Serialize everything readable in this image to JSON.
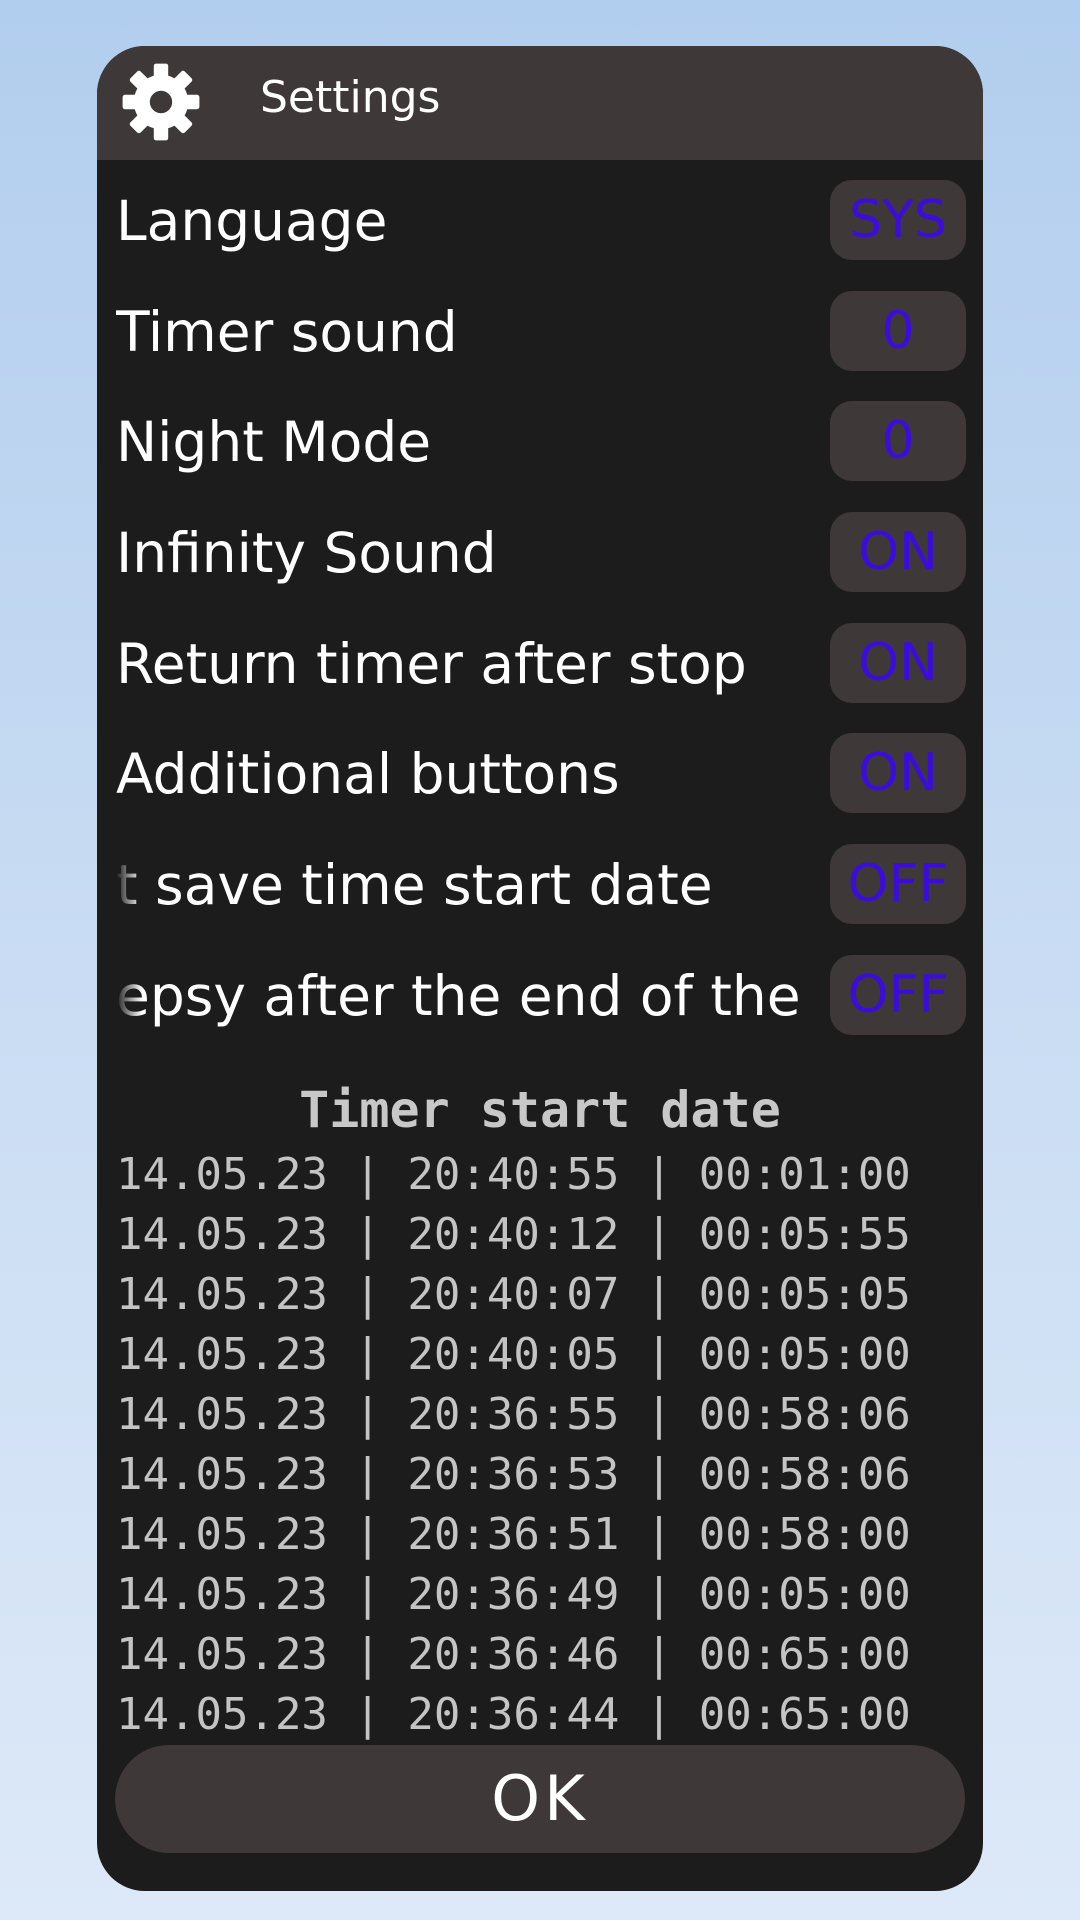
{
  "header": {
    "title": "Settings",
    "icon": "gear-icon"
  },
  "settings": [
    {
      "label": "Language",
      "value": "SYS"
    },
    {
      "label": "Timer sound",
      "value": "0"
    },
    {
      "label": "Night Mode",
      "value": "0"
    },
    {
      "label": "Infinity Sound",
      "value": "ON"
    },
    {
      "label": "Return timer after stop",
      "value": "ON"
    },
    {
      "label": "Additional buttons",
      "value": "ON"
    },
    {
      "label": "t save time start date",
      "value": "OFF"
    },
    {
      "label": "epsy after the end of the",
      "value": "OFF"
    }
  ],
  "history": {
    "title": "Timer start date",
    "rows": [
      "14.05.23 | 20:40:55 | 00:01:00",
      "14.05.23 | 20:40:12 | 00:05:55",
      "14.05.23 | 20:40:07 | 00:05:05",
      "14.05.23 | 20:40:05 | 00:05:00",
      "14.05.23 | 20:36:55 | 00:58:06",
      "14.05.23 | 20:36:53 | 00:58:06",
      "14.05.23 | 20:36:51 | 00:58:00",
      "14.05.23 | 20:36:49 | 00:05:00",
      "14.05.23 | 20:36:46 | 00:65:00",
      "14.05.23 | 20:36:44 | 00:65:00"
    ]
  },
  "ok_label": "OK",
  "colors": {
    "background_top": "#b2ceee",
    "dialog": "#1c1c1c",
    "header": "#3e3838",
    "toggle_text": "#3a0ddc",
    "history_text": "#c4c4c4"
  }
}
